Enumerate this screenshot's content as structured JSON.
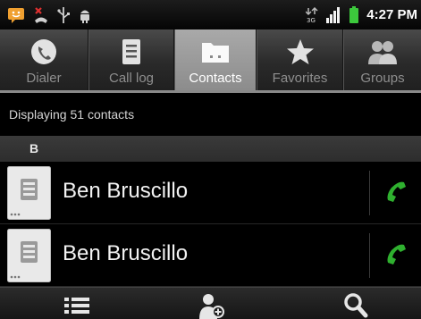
{
  "status_bar": {
    "time": "4:27 PM",
    "notification_icons": [
      "chat-notification-icon",
      "missed-call-icon",
      "usb-icon",
      "android-debug-icon"
    ],
    "status_icons": [
      "network-3g-icon",
      "signal-strength-icon",
      "battery-icon"
    ]
  },
  "tabs": [
    {
      "label": "Dialer",
      "icon": "phone-dial-icon",
      "active": false
    },
    {
      "label": "Call log",
      "icon": "call-log-icon",
      "active": false
    },
    {
      "label": "Contacts",
      "icon": "contacts-folder-icon",
      "active": true
    },
    {
      "label": "Favorites",
      "icon": "star-icon",
      "active": false
    },
    {
      "label": "Groups",
      "icon": "groups-icon",
      "active": false
    }
  ],
  "contact_count_text": "Displaying 51 contacts",
  "section_letter": "B",
  "contacts": [
    {
      "name": "Ben Bruscillo"
    },
    {
      "name": "Ben Bruscillo"
    }
  ],
  "bottom_actions": [
    "menu-list-icon",
    "add-contact-icon",
    "search-icon"
  ],
  "colors": {
    "call_green": "#2fb02f",
    "active_tab": "#9a9a9a",
    "battery_green": "#3cc83c"
  }
}
